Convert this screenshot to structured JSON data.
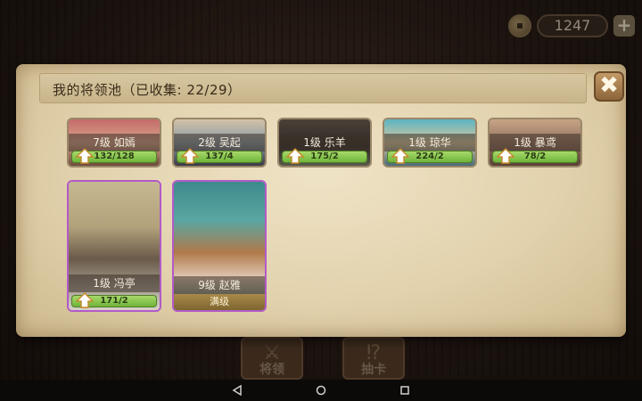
{
  "currency": {
    "value": "1247",
    "plus": "+"
  },
  "panel": {
    "title": "我的将领池（已收集: 22/29）",
    "close": "✖"
  },
  "cards_row1": [
    {
      "name": "7级  如嫣",
      "progress": "132/128"
    },
    {
      "name": "2级  吴起",
      "progress": "137/4"
    },
    {
      "name": "1级  乐羊",
      "progress": "175/2"
    },
    {
      "name": "1级  琼华",
      "progress": "224/2"
    },
    {
      "name": "1级  暴鸢",
      "progress": "78/2"
    }
  ],
  "cards_row2": [
    {
      "name": "1级  冯亭",
      "progress": "171/2"
    },
    {
      "name": "9级  赵雅",
      "status": "满级"
    }
  ],
  "bottom_nav": [
    {
      "label": "将领",
      "icon": "crossed-swords-icon"
    },
    {
      "label": "抽卡",
      "icon": "card-draw-icon"
    }
  ],
  "system_nav": [
    "back",
    "home",
    "recents"
  ],
  "colors": {
    "accent": "#b25ac8",
    "exp": "#8cc850",
    "parchment": "#e6d6b2"
  }
}
